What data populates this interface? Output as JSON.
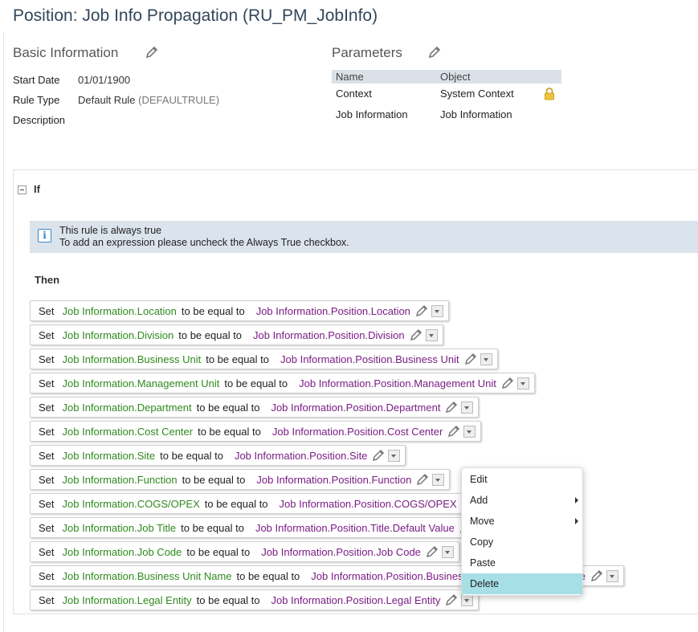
{
  "page_title": "Position: Job Info Propagation (RU_PM_JobInfo)",
  "basic_info": {
    "heading": "Basic Information",
    "start_date_label": "Start Date",
    "start_date": "01/01/1900",
    "rule_type_label": "Rule Type",
    "rule_type": "Default Rule",
    "rule_type_code": "(DEFAULTRULE)",
    "description_label": "Description"
  },
  "parameters": {
    "heading": "Parameters",
    "columns": [
      "Name",
      "Object"
    ],
    "rows": [
      {
        "name": "Context",
        "object": "System Context",
        "locked": true
      },
      {
        "name": "Job Information",
        "object": "Job Information",
        "locked": false
      }
    ]
  },
  "if_section": {
    "label": "If",
    "info_line1": "This rule is always true",
    "info_line2": "To add an expression please uncheck the Always True checkbox."
  },
  "then_section": {
    "label": "Then",
    "statements": [
      {
        "keyword": "Set",
        "lhs": "Job Information.Location",
        "op": "to be equal to",
        "rhs": "Job Information.Position.Location"
      },
      {
        "keyword": "Set",
        "lhs": "Job Information.Division",
        "op": "to be equal to",
        "rhs": "Job Information.Position.Division"
      },
      {
        "keyword": "Set",
        "lhs": "Job Information.Business Unit",
        "op": "to be equal to",
        "rhs": "Job Information.Position.Business Unit"
      },
      {
        "keyword": "Set",
        "lhs": "Job Information.Management Unit",
        "op": "to be equal to",
        "rhs": "Job Information.Position.Management Unit"
      },
      {
        "keyword": "Set",
        "lhs": "Job Information.Department",
        "op": "to be equal to",
        "rhs": "Job Information.Position.Department"
      },
      {
        "keyword": "Set",
        "lhs": "Job Information.Cost Center",
        "op": "to be equal to",
        "rhs": "Job Information.Position.Cost Center"
      },
      {
        "keyword": "Set",
        "lhs": "Job Information.Site",
        "op": "to be equal to",
        "rhs": "Job Information.Position.Site"
      },
      {
        "keyword": "Set",
        "lhs": "Job Information.Function",
        "op": "to be equal to",
        "rhs": "Job Information.Position.Function"
      },
      {
        "keyword": "Set",
        "lhs": "Job Information.COGS/OPEX",
        "op": "to be equal to",
        "rhs": "Job Information.Position.COGS/OPEX"
      },
      {
        "keyword": "Set",
        "lhs": "Job Information.Job Title",
        "op": "to be equal to",
        "rhs": "Job Information.Position.Title.Default Value"
      },
      {
        "keyword": "Set",
        "lhs": "Job Information.Job Code",
        "op": "to be equal to",
        "rhs": "Job Information.Position.Job Code"
      },
      {
        "keyword": "Set",
        "lhs": "Job Information.Business Unit Name",
        "op": "to be equal to",
        "rhs": "Job Information.Position.Business Unit.Name.Default Value"
      },
      {
        "keyword": "Set",
        "lhs": "Job Information.Legal Entity",
        "op": "to be equal to",
        "rhs": "Job Information.Position.Legal Entity"
      }
    ]
  },
  "context_menu": {
    "items": [
      {
        "label": "Edit",
        "submenu": false,
        "active": false
      },
      {
        "label": "Add",
        "submenu": true,
        "active": false
      },
      {
        "label": "Move",
        "submenu": true,
        "active": false
      },
      {
        "label": "Copy",
        "submenu": false,
        "active": false
      },
      {
        "label": "Paste",
        "submenu": false,
        "active": false
      },
      {
        "label": "Delete",
        "submenu": false,
        "active": true
      }
    ]
  },
  "colors": {
    "field_green": "#2f8a1e",
    "value_purple": "#7a1d85",
    "info_bg": "#dbe3ec",
    "menu_highlight": "#a6dfe6"
  }
}
